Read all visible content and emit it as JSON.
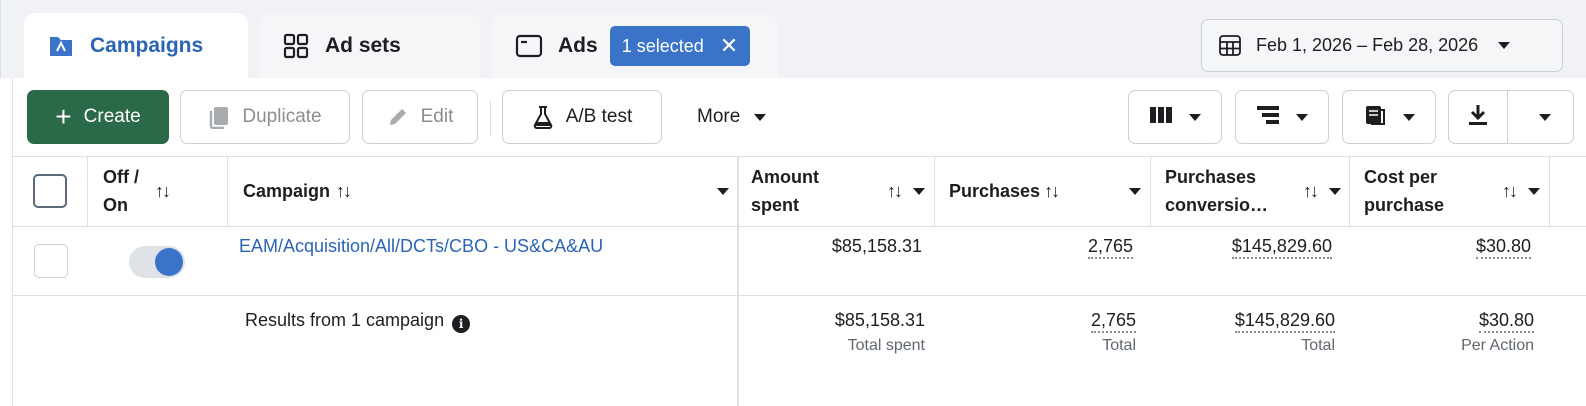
{
  "tabs": {
    "campaigns": "Campaigns",
    "adsets": "Ad sets",
    "ads": "Ads",
    "ads_selected": "1 selected"
  },
  "date_range": "Feb 1, 2026 – Feb 28, 2026",
  "toolbar": {
    "create": "Create",
    "duplicate": "Duplicate",
    "edit": "Edit",
    "ab_test": "A/B test",
    "more": "More"
  },
  "columns": {
    "off_on": [
      "Off /",
      "On"
    ],
    "campaign": "Campaign",
    "amount_spent": [
      "Amount",
      "spent"
    ],
    "purchases": "Purchases",
    "purchases_conversion": [
      "Purchases",
      "conversio…"
    ],
    "cost_per_purchase": [
      "Cost per",
      "purchase"
    ]
  },
  "row": {
    "campaign_name": "EAM/Acquisition/All/DCTs/CBO - US&CA&AU",
    "toggle_on": true,
    "amount_spent": "$85,158.31",
    "purchases": "2,765",
    "purchases_conversion": "$145,829.60",
    "cost_per_purchase": "$30.80"
  },
  "summary": {
    "label": "Results from 1 campaign",
    "amount_spent": "$85,158.31",
    "amount_spent_sub": "Total spent",
    "purchases": "2,765",
    "purchases_sub": "Total",
    "purchases_conversion": "$145,829.60",
    "purchases_conversion_sub": "Total",
    "cost_per_purchase": "$30.80",
    "cost_per_purchase_sub": "Per Action"
  },
  "colors": {
    "accent_blue": "#2c64b4",
    "create_green": "#2b6a48",
    "pill_blue": "#3a73c8"
  }
}
